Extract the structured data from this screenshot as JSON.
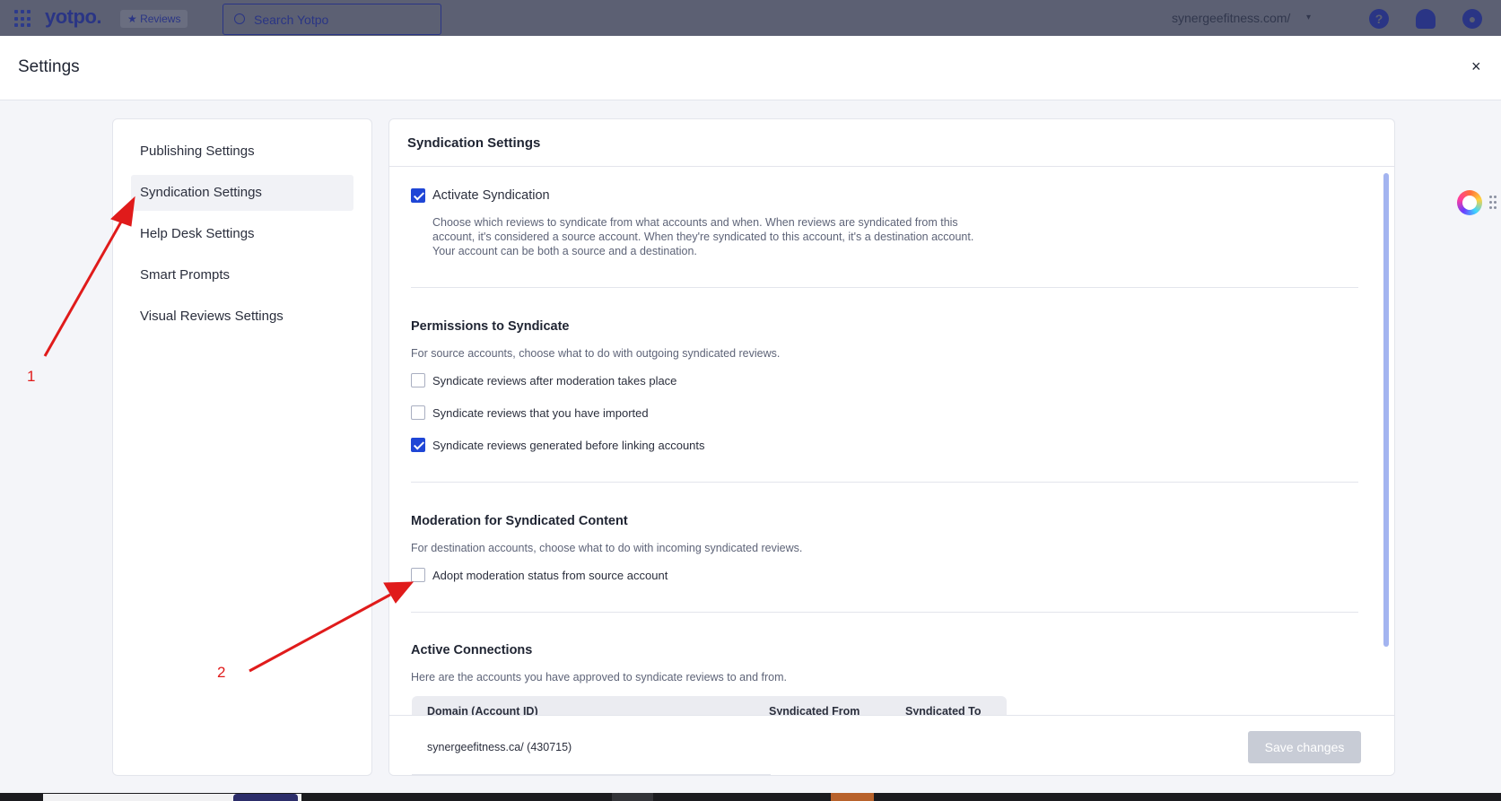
{
  "topnav": {
    "logo": "yotpo.",
    "product": "★ Reviews",
    "search_placeholder": "Search Yotpo",
    "account": "synergeefitness.com/",
    "help_icon": "?",
    "notifications_icon": "bell-icon",
    "profile_icon": "user-icon"
  },
  "header": {
    "title": "Settings",
    "close": "×"
  },
  "sidebar": {
    "items": [
      {
        "label": "Publishing Settings",
        "active": false
      },
      {
        "label": "Syndication Settings",
        "active": true
      },
      {
        "label": "Help Desk Settings",
        "active": false
      },
      {
        "label": "Smart Prompts",
        "active": false
      },
      {
        "label": "Visual Reviews Settings",
        "active": false
      }
    ]
  },
  "main": {
    "title": "Syndication Settings",
    "activate": {
      "label": "Activate Syndication",
      "checked": true,
      "description_lines": [
        "Choose which reviews to syndicate from what accounts and when. When reviews are syndicated from this",
        "account, it's considered a source account. When they're syndicated to this account, it's a destination account.",
        "Your account can be both a source and a destination."
      ]
    },
    "permissions": {
      "title": "Permissions to Syndicate",
      "description": "For source accounts, choose what to do with outgoing syndicated reviews.",
      "options": [
        {
          "label": "Syndicate reviews after moderation takes place",
          "checked": false
        },
        {
          "label": "Syndicate reviews that you have imported",
          "checked": false
        },
        {
          "label": "Syndicate reviews generated before linking accounts",
          "checked": true
        }
      ]
    },
    "moderation": {
      "title": "Moderation for Syndicated Content",
      "description": "For destination accounts, choose what to do with incoming syndicated reviews.",
      "option": {
        "label": "Adopt moderation status from source account",
        "checked": false
      }
    },
    "connections": {
      "title": "Active Connections",
      "description": "Here are the accounts you have approved to syndicate reviews to and from.",
      "columns": [
        "Domain (Account ID)",
        "Syndicated From",
        "Syndicated To"
      ],
      "rows": [
        {
          "domain": "synergeefitness.ca/ (430715)"
        }
      ]
    },
    "save_label": "Save changes"
  },
  "annotations": {
    "one": "1",
    "two": "2",
    "color": "#e01b1b"
  }
}
